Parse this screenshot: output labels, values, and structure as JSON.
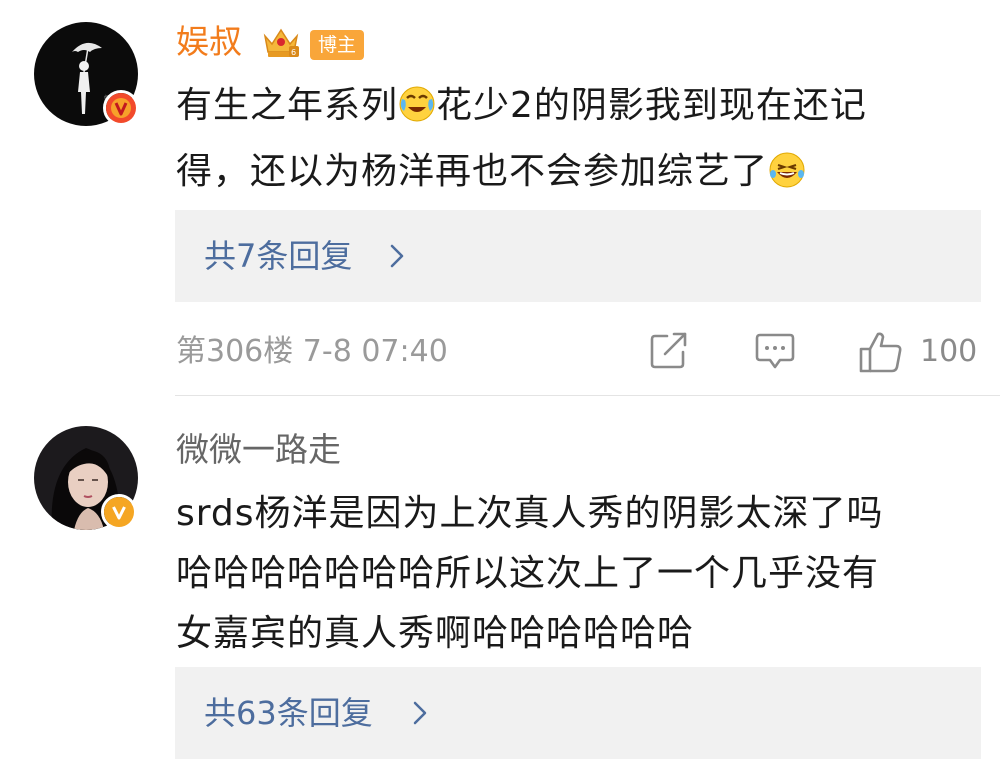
{
  "comments": [
    {
      "username": "娱叔",
      "role_badge": "博主",
      "text_line1_a": "有生之年系列",
      "text_line1_b": "花少2的阴影我到现在还记",
      "text_line2": "得，还以为杨洋再也不会参加综艺了",
      "emoji_1": "crying-laughing-emoji",
      "emoji_2": "laughing-tears-emoji",
      "replies_label": "共7条回复",
      "floor_time": "第306楼  7-8 07:40",
      "like_count": "100"
    },
    {
      "username": "微微一路走",
      "text_line1": "srds杨洋是因为上次真人秀的阴影太深了吗",
      "text_line2": "哈哈哈哈哈哈哈所以这次上了一个几乎没有",
      "text_line3": "女嘉宾的真人秀啊哈哈哈哈哈哈",
      "replies_label": "共63条回复"
    }
  ],
  "icons": {
    "verified": "verified-v-icon",
    "crown": "crown-level-icon",
    "share": "share-icon",
    "comment": "comment-icon",
    "like": "like-thumb-icon",
    "chevron": "chevron-right-icon"
  },
  "colors": {
    "owner_name": "#f27c1c",
    "reply_link": "#4d6d9e",
    "verified_badge": "#f5a623",
    "meta_gray": "#9a9a9a",
    "reply_box_bg": "#f1f1f1"
  }
}
